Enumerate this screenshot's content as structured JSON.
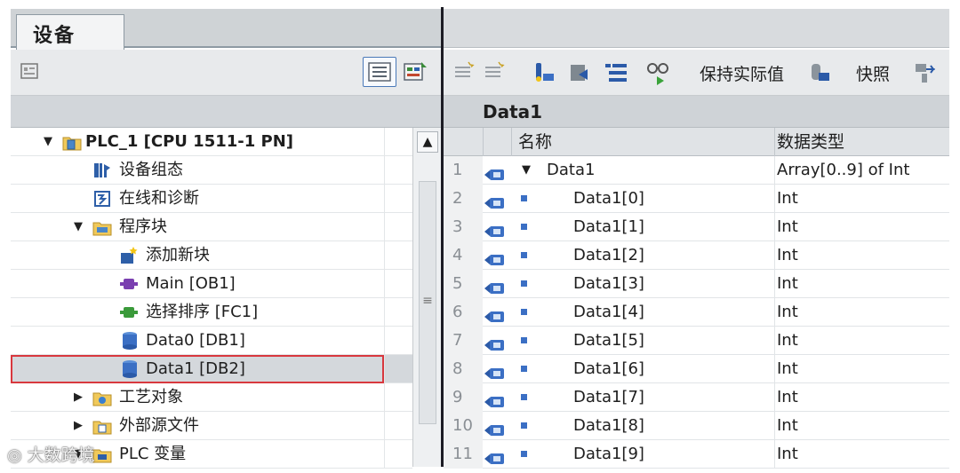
{
  "left_pane": {
    "tab_title": "设备",
    "tree": [
      {
        "label": "PLC_1 [CPU 1511-1 PN]",
        "icon": "plc-folder-icon",
        "expanded": true,
        "bold": true
      },
      {
        "label": "设备组态",
        "icon": "device-config-icon"
      },
      {
        "label": "在线和诊断",
        "icon": "online-diagnostics-icon"
      },
      {
        "label": "程序块",
        "icon": "program-blocks-folder-icon",
        "expanded": true
      },
      {
        "label": "添加新块",
        "icon": "add-block-icon"
      },
      {
        "label": "Main [OB1]",
        "icon": "ob-block-icon"
      },
      {
        "label": "选择排序 [FC1]",
        "icon": "fc-block-icon"
      },
      {
        "label": "Data0 [DB1]",
        "icon": "db-block-icon"
      },
      {
        "label": "Data1 [DB2]",
        "icon": "db-block-icon",
        "selected": true
      },
      {
        "label": "工艺对象",
        "icon": "technology-objects-folder-icon",
        "expanded": false
      },
      {
        "label": "外部源文件",
        "icon": "external-sources-folder-icon",
        "expanded": false
      },
      {
        "label": "PLC 变量",
        "icon": "plc-tags-folder-icon",
        "expanded": true
      }
    ]
  },
  "right_pane": {
    "toolbar": {
      "keep_actual_values_label": "保持实际值",
      "snapshot_label": "快照"
    },
    "block_title": "Data1",
    "columns": {
      "name": "名称",
      "data_type": "数据类型"
    },
    "rows": [
      {
        "num": "1",
        "name": "Data1",
        "type": "Array[0..9] of Int",
        "expandable": true
      },
      {
        "num": "2",
        "name": "Data1[0]",
        "type": "Int"
      },
      {
        "num": "3",
        "name": "Data1[1]",
        "type": "Int"
      },
      {
        "num": "4",
        "name": "Data1[2]",
        "type": "Int"
      },
      {
        "num": "5",
        "name": "Data1[3]",
        "type": "Int"
      },
      {
        "num": "6",
        "name": "Data1[4]",
        "type": "Int"
      },
      {
        "num": "7",
        "name": "Data1[5]",
        "type": "Int"
      },
      {
        "num": "8",
        "name": "Data1[6]",
        "type": "Int"
      },
      {
        "num": "9",
        "name": "Data1[7]",
        "type": "Int"
      },
      {
        "num": "10",
        "name": "Data1[8]",
        "type": "Int"
      },
      {
        "num": "11",
        "name": "Data1[9]",
        "type": "Int"
      }
    ]
  },
  "watermark": "大数跨境",
  "colors": {
    "selection_border": "#d8383e",
    "db_blue": "#3b6fc4",
    "header_gray": "#cfd3d7"
  }
}
